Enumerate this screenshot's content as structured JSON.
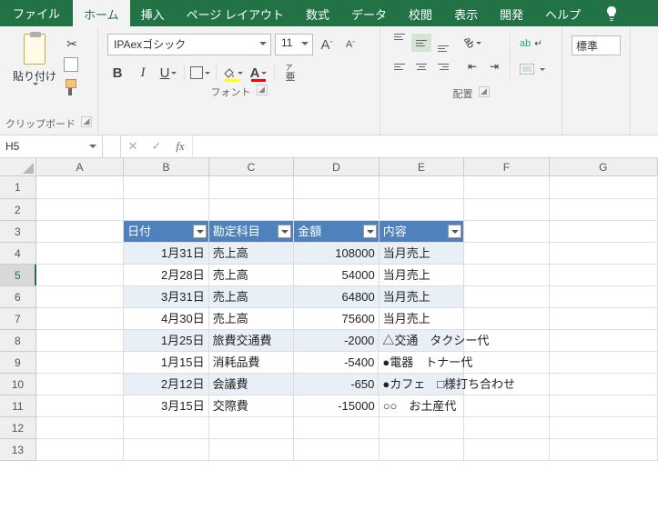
{
  "tabs": {
    "file": "ファイル",
    "home": "ホーム",
    "insert": "挿入",
    "pagelayout": "ページ レイアウト",
    "formulas": "数式",
    "data": "データ",
    "review": "校閲",
    "view": "表示",
    "developer": "開発",
    "help": "ヘルプ"
  },
  "ribbon": {
    "clipboard": {
      "paste": "貼り付け",
      "group": "クリップボード"
    },
    "font": {
      "name": "IPAexゴシック",
      "size": "11",
      "group": "フォント",
      "bold": "B",
      "italic": "I",
      "underline": "U",
      "fontcolor_a": "A",
      "bigA": "A",
      "smallA": "A",
      "ruby_top": "ア",
      "ruby_bot": "亜"
    },
    "align": {
      "group": "配置",
      "wrap": "ab",
      "merge": ""
    },
    "number": {
      "style": "標準"
    }
  },
  "fx": {
    "namebox": "H5",
    "cancel": "✕",
    "enter": "✓",
    "fx": "fx"
  },
  "cols": [
    "A",
    "B",
    "C",
    "D",
    "E",
    "F",
    "G"
  ],
  "rownums": [
    "1",
    "2",
    "3",
    "4",
    "5",
    "6",
    "7",
    "8",
    "9",
    "10",
    "11",
    "12",
    "13"
  ],
  "table": {
    "headers": {
      "b": "日付",
      "c": "勘定科目",
      "d": "金額",
      "e": "内容"
    },
    "rows": [
      {
        "b": "1月31日",
        "c": "売上高",
        "d": "108000",
        "e": "当月売上"
      },
      {
        "b": "2月28日",
        "c": "売上高",
        "d": "54000",
        "e": "当月売上"
      },
      {
        "b": "3月31日",
        "c": "売上高",
        "d": "64800",
        "e": "当月売上"
      },
      {
        "b": "4月30日",
        "c": "売上高",
        "d": "75600",
        "e": "当月売上"
      },
      {
        "b": "1月25日",
        "c": "旅費交通費",
        "d": "-2000",
        "e": "△交通　タクシー代"
      },
      {
        "b": "1月15日",
        "c": "消耗品費",
        "d": "-5400",
        "e": "●電器　トナー代"
      },
      {
        "b": "2月12日",
        "c": "会議費",
        "d": "-650",
        "e": "●カフェ　□様打ち合わせ"
      },
      {
        "b": "3月15日",
        "c": "交際費",
        "d": "-15000",
        "e": "○○　お土産代"
      }
    ]
  }
}
